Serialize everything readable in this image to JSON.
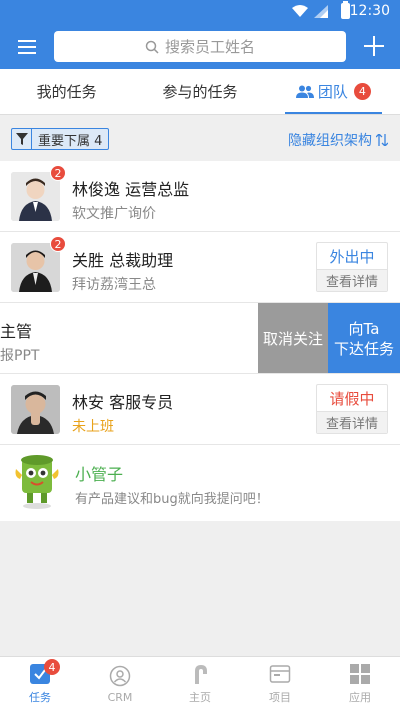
{
  "status_bar": {
    "time": "12:30"
  },
  "header": {
    "search_placeholder": "搜索员工姓名"
  },
  "tabs": [
    {
      "label": "我的任务"
    },
    {
      "label": "参与的任务"
    },
    {
      "label": "团队",
      "badge": "4",
      "active": true
    }
  ],
  "filter": {
    "chip_label": "重要下属 4",
    "hide_org_label": "隐藏组织架构"
  },
  "members": [
    {
      "name": "林俊逸  运营总监",
      "sub": "软文推广询价",
      "badge": "2"
    },
    {
      "name": "关胜  总裁助理",
      "sub": "拜访荔湾王总",
      "badge": "2",
      "status": "外出中",
      "detail": "查看详情"
    },
    {
      "name": "主管",
      "sub": "汇报PPT",
      "swipe_unfollow": "取消关注",
      "swipe_assign_line1": "向Ta",
      "swipe_assign_line2": "下达任务"
    },
    {
      "name": "林安  客服专员",
      "sub": "未上班",
      "status": "请假中",
      "detail": "查看详情"
    }
  ],
  "bot": {
    "name": "小管子",
    "sub": "有产品建议和bug就向我提问吧！"
  },
  "bottom_nav": [
    {
      "label": "任务",
      "badge": "4",
      "active": true,
      "icon": "task-icon"
    },
    {
      "label": "CRM",
      "icon": "crm-icon"
    },
    {
      "label": "主页",
      "icon": "home-icon"
    },
    {
      "label": "项目",
      "icon": "project-icon"
    },
    {
      "label": "应用",
      "icon": "apps-icon"
    }
  ]
}
